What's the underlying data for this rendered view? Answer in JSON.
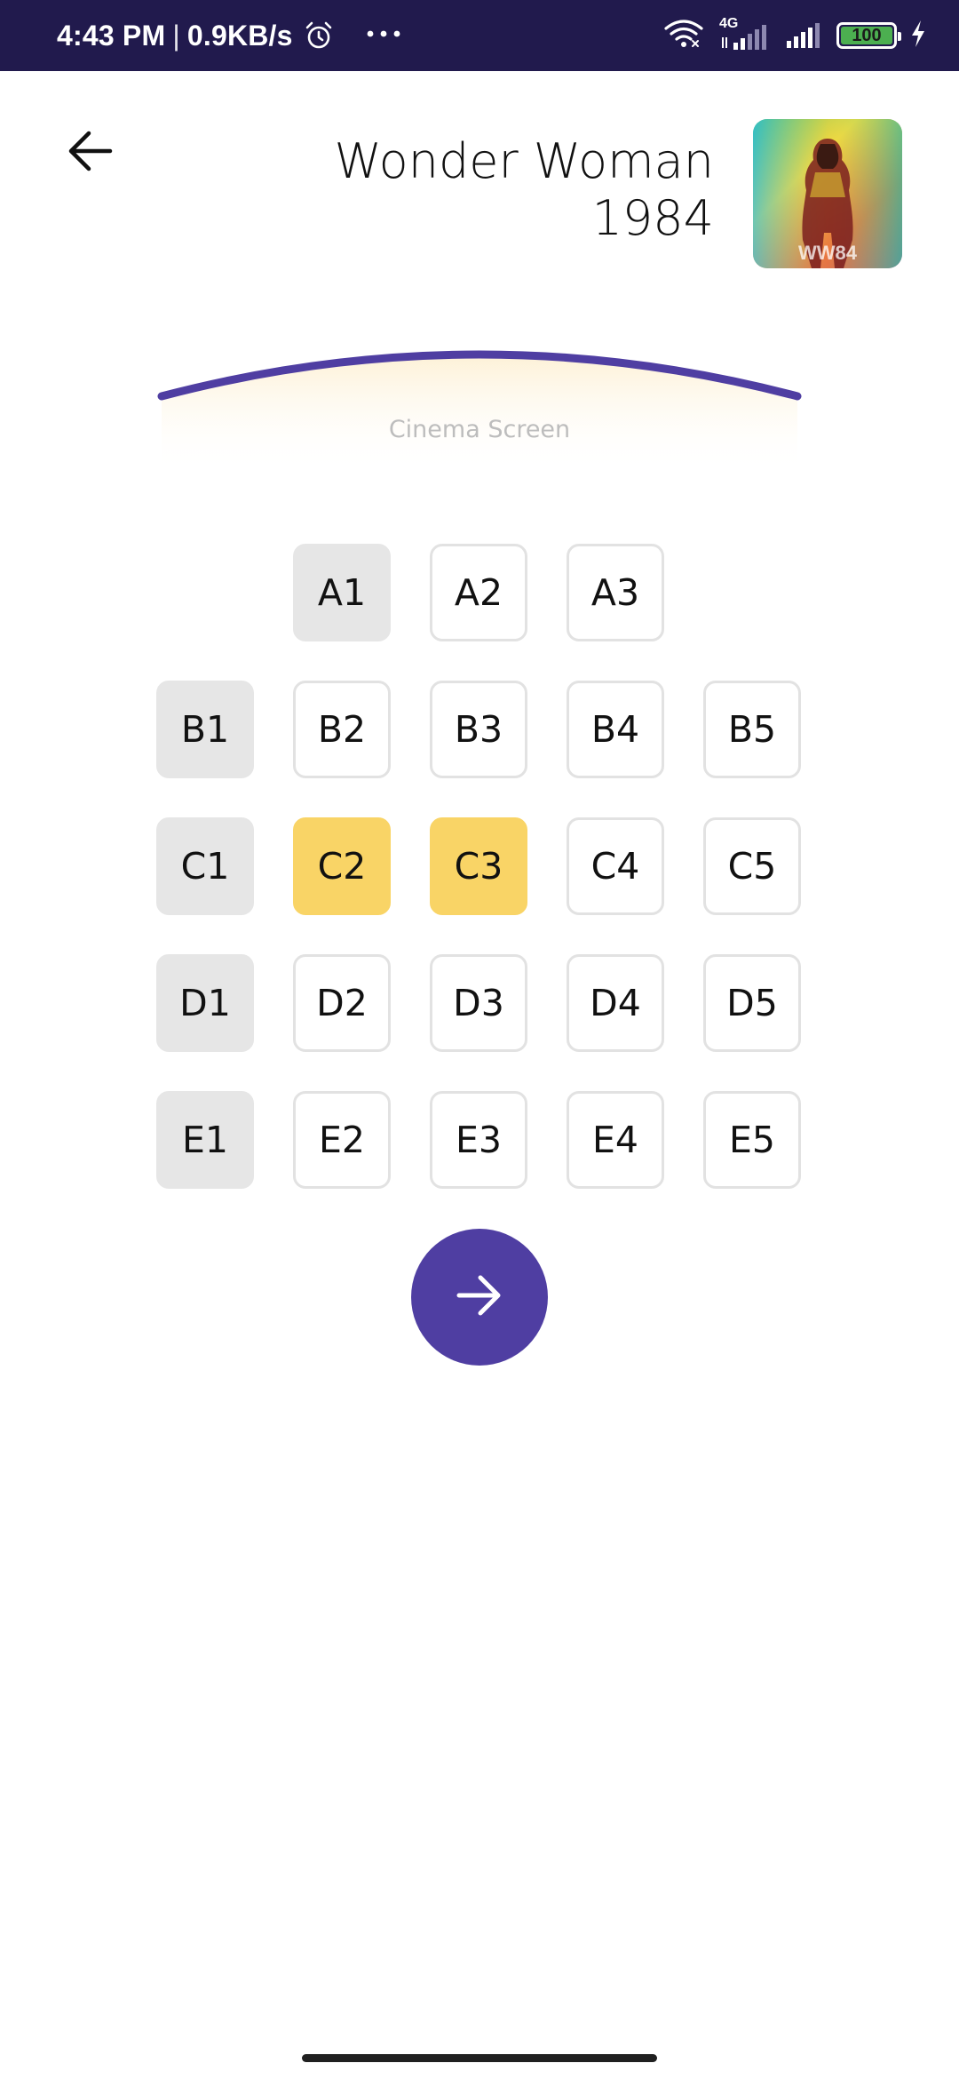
{
  "status_bar": {
    "time": "4:43 PM",
    "separator": "|",
    "net_speed": "0.9KB/s",
    "network_type": "4G",
    "battery_level": "100",
    "battery_fraction": 1.0,
    "battery_color": "#4caf50",
    "background": "#211a4d",
    "icons": [
      "alarm-icon",
      "more-icon",
      "wifi-icon",
      "signal-icon",
      "signal-icon",
      "battery-icon",
      "charging-icon"
    ]
  },
  "header": {
    "title_line1": "Wonder Woman",
    "title_line2": "1984",
    "back_icon": "arrow-left-icon",
    "poster_logo_text": "WW84"
  },
  "screen": {
    "label": "Cinema Screen",
    "arc_color": "#4f3ea2"
  },
  "seat_colors": {
    "available": "#ffffff",
    "unavailable": "#e6e6e6",
    "selected": "#f9d466"
  },
  "seats": {
    "rows": [
      {
        "row": "A",
        "seats": [
          {
            "label": "A1",
            "status": "unavailable"
          },
          {
            "label": "A2",
            "status": "available"
          },
          {
            "label": "A3",
            "status": "available"
          }
        ]
      },
      {
        "row": "B",
        "seats": [
          {
            "label": "B1",
            "status": "unavailable"
          },
          {
            "label": "B2",
            "status": "available"
          },
          {
            "label": "B3",
            "status": "available"
          },
          {
            "label": "B4",
            "status": "available"
          },
          {
            "label": "B5",
            "status": "available"
          }
        ]
      },
      {
        "row": "C",
        "seats": [
          {
            "label": "C1",
            "status": "unavailable"
          },
          {
            "label": "C2",
            "status": "selected"
          },
          {
            "label": "C3",
            "status": "selected"
          },
          {
            "label": "C4",
            "status": "available"
          },
          {
            "label": "C5",
            "status": "available"
          }
        ]
      },
      {
        "row": "D",
        "seats": [
          {
            "label": "D1",
            "status": "unavailable"
          },
          {
            "label": "D2",
            "status": "available"
          },
          {
            "label": "D3",
            "status": "available"
          },
          {
            "label": "D4",
            "status": "available"
          },
          {
            "label": "D5",
            "status": "available"
          }
        ]
      },
      {
        "row": "E",
        "seats": [
          {
            "label": "E1",
            "status": "unavailable"
          },
          {
            "label": "E2",
            "status": "available"
          },
          {
            "label": "E3",
            "status": "available"
          },
          {
            "label": "E4",
            "status": "available"
          },
          {
            "label": "E5",
            "status": "available"
          }
        ]
      }
    ]
  },
  "next_button": {
    "icon": "arrow-right-icon",
    "color": "#4f3ea2"
  }
}
